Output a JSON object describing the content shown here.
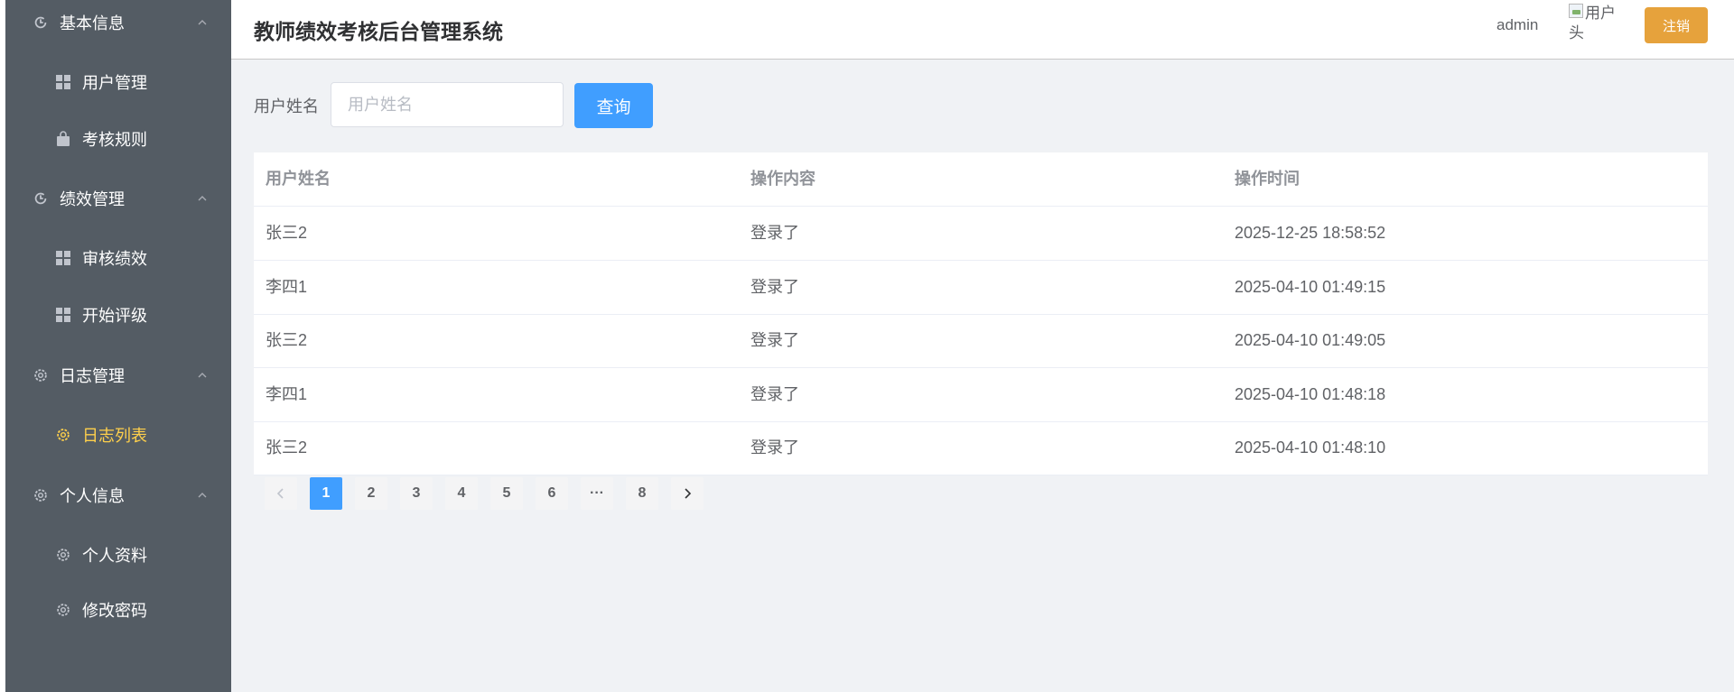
{
  "sidebar": {
    "groups": [
      {
        "title": "基本信息",
        "items": [
          {
            "label": "用户管理",
            "icon": "grid-icon"
          },
          {
            "label": "考核规则",
            "icon": "bag-icon"
          }
        ]
      },
      {
        "title": "绩效管理",
        "items": [
          {
            "label": "审核绩效",
            "icon": "grid-icon"
          },
          {
            "label": "开始评级",
            "icon": "grid-icon"
          }
        ]
      },
      {
        "title": "日志管理",
        "items": [
          {
            "label": "日志列表",
            "icon": "gear-icon",
            "active": true
          }
        ]
      },
      {
        "title": "个人信息",
        "items": [
          {
            "label": "个人资料",
            "icon": "gear-icon"
          },
          {
            "label": "修改密码",
            "icon": "gear-icon"
          }
        ]
      }
    ],
    "colors": {
      "background": "#545c64",
      "text": "#ffffff",
      "active": "#ffd04b"
    }
  },
  "header": {
    "title": "教师绩效考核后台管理系统",
    "username": "admin",
    "avatar_alt": "用户头",
    "logout_label": "注销"
  },
  "search": {
    "label": "用户姓名",
    "placeholder": "用户姓名",
    "value": "",
    "button_label": "查询"
  },
  "table": {
    "columns": [
      "用户姓名",
      "操作内容",
      "操作时间"
    ],
    "rows": [
      [
        "张三2",
        "登录了",
        "2025-12-25 18:58:52"
      ],
      [
        "李四1",
        "登录了",
        "2025-04-10 01:49:15"
      ],
      [
        "张三2",
        "登录了",
        "2025-04-10 01:49:05"
      ],
      [
        "李四1",
        "登录了",
        "2025-04-10 01:48:18"
      ],
      [
        "张三2",
        "登录了",
        "2025-04-10 01:48:10"
      ]
    ]
  },
  "pagination": {
    "pages": [
      "1",
      "2",
      "3",
      "4",
      "5",
      "6",
      "···",
      "8"
    ],
    "current": "1"
  },
  "colors": {
    "primary": "#409eff",
    "warning": "#e6a23c",
    "main_bg": "#f0f2f5"
  }
}
